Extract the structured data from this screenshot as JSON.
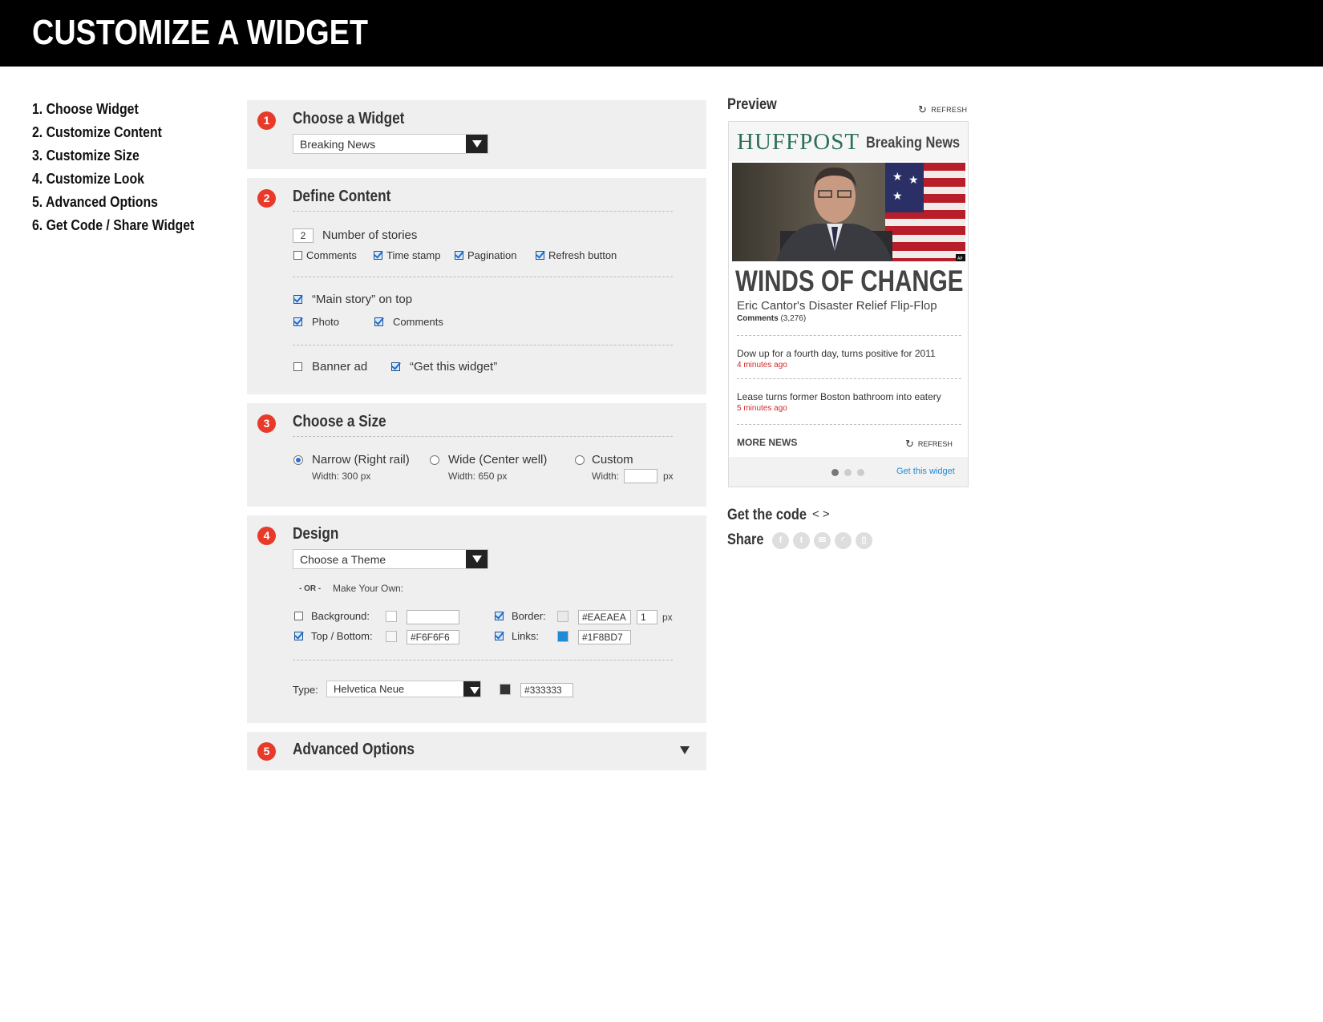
{
  "header": {
    "title": "CUSTOMIZE A WIDGET"
  },
  "steps": [
    "1. Choose Widget",
    "2. Customize Content",
    "3. Customize Size",
    "4. Customize Look",
    "5. Advanced Options",
    "6. Get Code / Share Widget"
  ],
  "panel1": {
    "num": "1",
    "title": "Choose a Widget",
    "select_value": "Breaking News"
  },
  "panel2": {
    "num": "2",
    "title": "Define Content",
    "num_stories_value": "2",
    "num_stories_label": "Number of stories",
    "opts": [
      {
        "label": "Comments",
        "checked": false
      },
      {
        "label": "Time stamp",
        "checked": true
      },
      {
        "label": "Pagination",
        "checked": true
      },
      {
        "label": "Refresh button",
        "checked": true
      }
    ],
    "main_story": {
      "label": "“Main story” on top",
      "checked": true
    },
    "photo": {
      "label": "Photo",
      "checked": true
    },
    "main_comments": {
      "label": "Comments",
      "checked": true
    },
    "banner_ad": {
      "label": "Banner ad",
      "checked": false
    },
    "get_widget": {
      "label": "“Get this widget”",
      "checked": true
    }
  },
  "panel3": {
    "num": "3",
    "title": "Choose a Size",
    "narrow": {
      "label": "Narrow (Right rail)",
      "sub": "Width: 300 px",
      "selected": true
    },
    "wide": {
      "label": "Wide (Center well)",
      "sub": "Width: 650 px",
      "selected": false
    },
    "custom": {
      "label": "Custom",
      "width_label": "Width:",
      "unit": "px",
      "selected": false
    }
  },
  "panel4": {
    "num": "4",
    "title": "Design",
    "theme_select": "Choose a Theme",
    "or_label": "- OR -",
    "make_own": "Make Your Own:",
    "background": {
      "label": "Background:",
      "checked": false,
      "value": "",
      "color": "#FFFFFF"
    },
    "topbottom": {
      "label": "Top / Bottom:",
      "checked": true,
      "value": "#F6F6F6",
      "color": "#F6F6F6"
    },
    "border": {
      "label": "Border:",
      "checked": true,
      "value": "#EAEAEA",
      "color": "#EAEAEA",
      "width": "1",
      "unit": "px"
    },
    "links": {
      "label": "Links:",
      "checked": true,
      "value": "#1F8BD7",
      "color": "#1F8BD7"
    },
    "type_label": "Type:",
    "type_font": "Helvetica Neue",
    "type_value": "#333333",
    "type_color": "#333333"
  },
  "panel5": {
    "num": "5",
    "title": "Advanced Options"
  },
  "preview": {
    "title": "Preview",
    "refresh": "REFRESH",
    "logo": "HUFFPOST",
    "widget_title": "Breaking News",
    "photo_credit": "AP",
    "headline": "WINDS OF CHANGE",
    "subhead": "Eric Cantor's Disaster Relief Flip-Flop",
    "comments_label": "Comments",
    "comments_count": "(3,276)",
    "items": [
      {
        "title": "Dow up for a fourth day, turns positive for 2011",
        "time": "4 minutes ago"
      },
      {
        "title": "Lease turns former Boston bathroom into eatery",
        "time": "5 minutes ago"
      }
    ],
    "more_news": "MORE NEWS",
    "refresh_bottom": "REFRESH",
    "get_widget": "Get this widget",
    "page_active": 1,
    "page_count": 3
  },
  "sidebar_bottom": {
    "get_code": "Get the code",
    "code_icon": "< >",
    "share": "Share",
    "share_icons": [
      "facebook-icon",
      "twitter-icon",
      "email-icon",
      "rss-icon",
      "mobile-icon"
    ]
  },
  "colors": {
    "accent": "#E83A2B",
    "brand": "#2C7058",
    "link": "#1F8BD7",
    "time": "#D42A2A"
  }
}
